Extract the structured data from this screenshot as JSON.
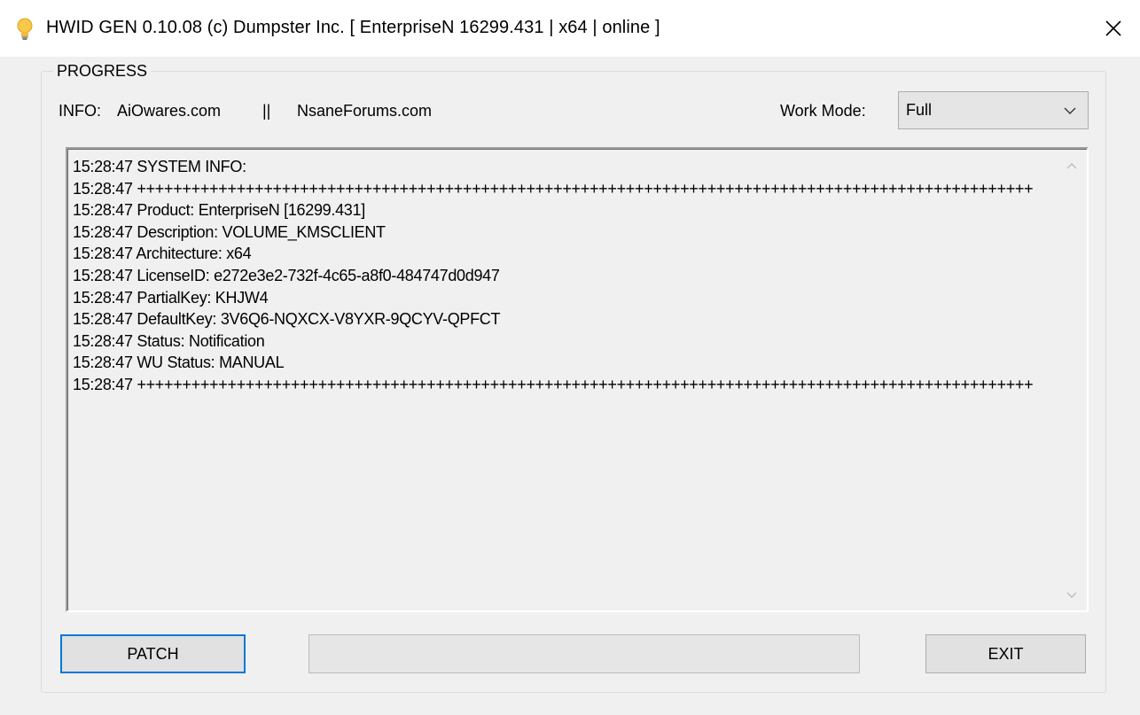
{
  "window": {
    "title": "HWID GEN 0.10.08 (c) Dumpster Inc. [ EnterpriseN 16299.431 | x64 | online ]",
    "app_icon": "lightbulb-icon",
    "close_glyph": "✕"
  },
  "group": {
    "title": "PROGRESS"
  },
  "info": {
    "label": "INFO:",
    "link1": "AiOwares.com",
    "separator": "||",
    "link2": "NsaneForums.com"
  },
  "work_mode": {
    "label": "Work Mode:",
    "selected": "Full"
  },
  "log": {
    "lines": [
      "15:28:47 SYSTEM INFO:",
      "15:28:47 +++++++++++++++++++++++++++++++++++++++++++++++++++++++++++++++++++++++++++++++++++++++++++++++++++",
      "15:28:47 Product: EnterpriseN [16299.431]",
      "15:28:47 Description: VOLUME_KMSCLIENT",
      "15:28:47 Architecture: x64",
      "15:28:47 LicenseID: e272e3e2-732f-4c65-a8f0-484747d0d947",
      "15:28:47 PartialKey: KHJW4",
      "15:28:47 DefaultKey: 3V6Q6-NQXCX-V8YXR-9QCYV-QPFCT",
      "15:28:47 Status: Notification",
      "15:28:47 WU Status: MANUAL",
      "15:28:47 +++++++++++++++++++++++++++++++++++++++++++++++++++++++++++++++++++++++++++++++++++++++++++++++++++"
    ]
  },
  "buttons": {
    "patch": "PATCH",
    "exit": "EXIT"
  },
  "progress": {
    "value": 0
  },
  "colors": {
    "window_bg": "#f0f0f0",
    "focus_border": "#0078d7",
    "progress_fill": "#06b025"
  }
}
